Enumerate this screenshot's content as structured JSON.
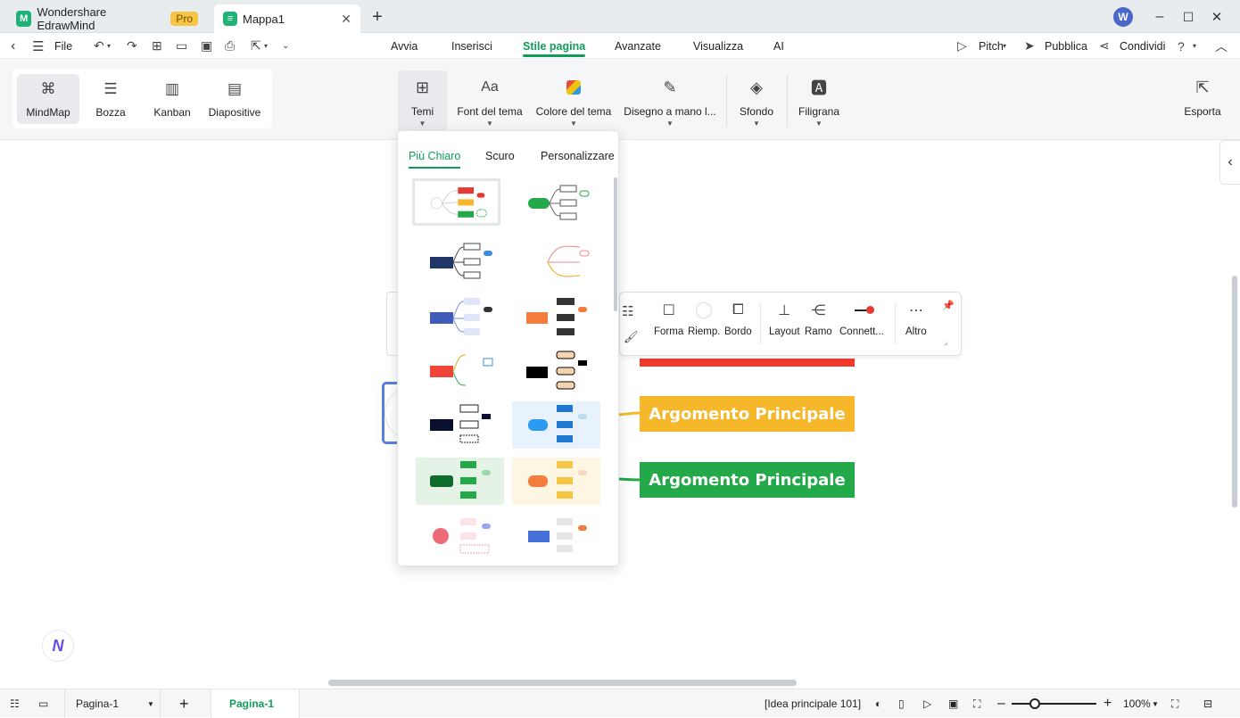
{
  "titlebar": {
    "app_name": "Wondershare EdrawMind",
    "pro_badge": "Pro",
    "doc_tab": "Mappa1",
    "avatar_letter": "W"
  },
  "menubar": {
    "file": "File",
    "items": [
      "Avvia",
      "Inserisci",
      "Stile pagina",
      "Avanzate",
      "Visualizza",
      "AI"
    ],
    "active": "Stile pagina",
    "pitch": "Pitch",
    "publish": "Pubblica",
    "share": "Condividi"
  },
  "ribbon": {
    "views": [
      "MindMap",
      "Bozza",
      "Kanban",
      "Diapositive"
    ],
    "selected_view": "MindMap",
    "theme": "Temi",
    "font": "Font del tema",
    "color": "Colore del tema",
    "hand": "Disegno a mano l...",
    "background": "Sfondo",
    "watermark": "Filigrana",
    "export": "Esporta"
  },
  "theme_panel": {
    "tabs": [
      "Più Chiaro",
      "Scuro",
      "Personalizzare"
    ],
    "active_tab": "Più Chiaro"
  },
  "floatbar": {
    "shape": "Forma",
    "fill": "Riemp.",
    "border": "Bordo",
    "layout": "Layout",
    "branch": "Ramo",
    "connector": "Connett...",
    "more": "Altro"
  },
  "canvas": {
    "topic_yellow": "Argomento Principale",
    "topic_green": "Argomento Principale",
    "colors": {
      "red": "#f0382b",
      "yellow": "#f6b72b",
      "green": "#23a84a"
    }
  },
  "statusbar": {
    "page_select": "Pagina-1",
    "page_tab": "Pagina-1",
    "idea_count": "[Idea principale 101]",
    "zoom": "100%"
  },
  "accent": "#0f9d58"
}
